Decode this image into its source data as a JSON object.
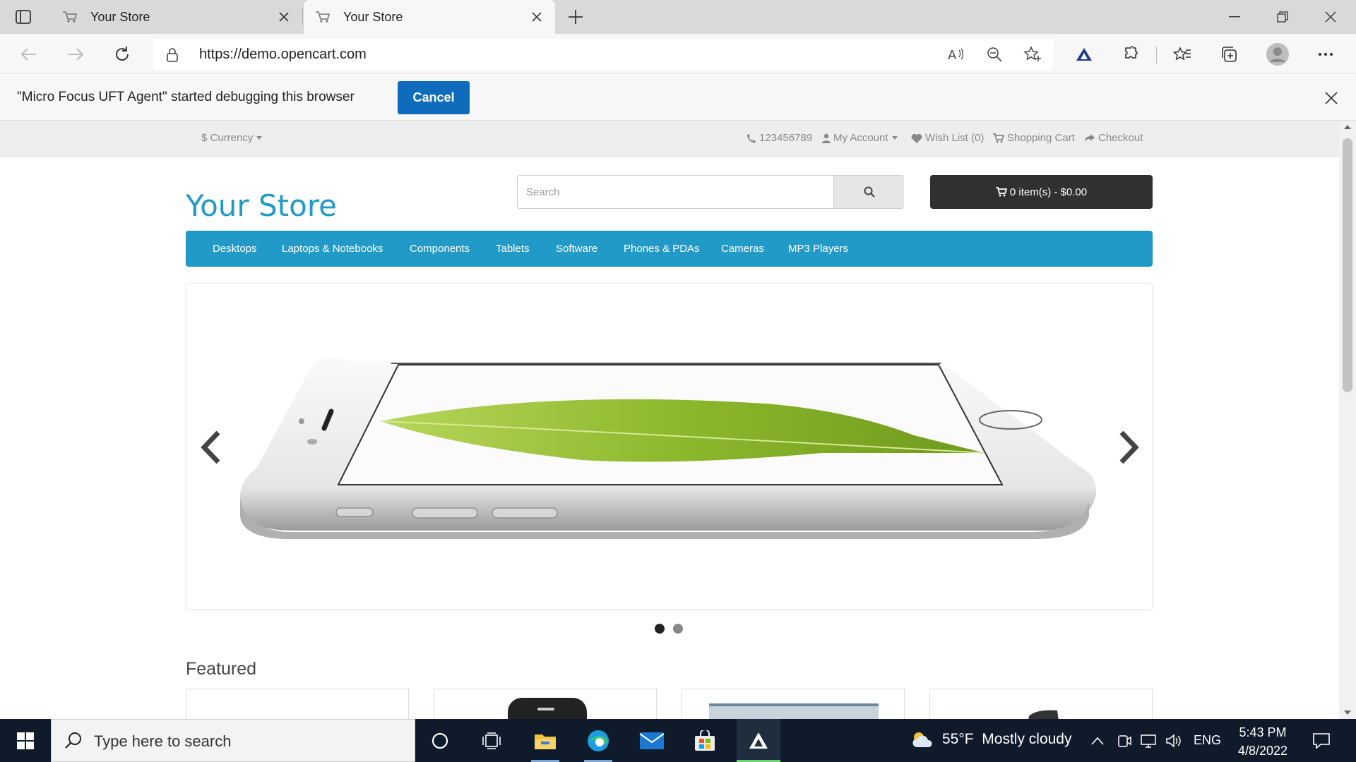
{
  "browser": {
    "tabs": [
      {
        "title": "Your Store",
        "state": "inactive"
      },
      {
        "title": "Your Store",
        "state": "active"
      }
    ],
    "address": {
      "url": "https://demo.opencart.com"
    },
    "infobar": {
      "message": "\"Micro Focus UFT Agent\" started debugging this browser",
      "cancel_label": "Cancel"
    },
    "accent_color": "#0f6cbd"
  },
  "store": {
    "topbar": {
      "currency_label": "Currency",
      "currency_symbol": "$",
      "phone": "123456789",
      "my_account": "My Account",
      "wish_list": "Wish List (0)",
      "shopping_cart": "Shopping Cart",
      "checkout": "Checkout"
    },
    "logo": "Your Store",
    "search": {
      "placeholder": "Search"
    },
    "cart_button": "0 item(s) - $0.00",
    "menu": [
      "Desktops",
      "Laptops & Notebooks",
      "Components",
      "Tablets",
      "Software",
      "Phones & PDAs",
      "Cameras",
      "MP3 Players"
    ],
    "slideshow": {
      "slide_count": 2,
      "active_slide": 1
    },
    "featured_title": "Featured",
    "brand_color": "#229ac8"
  },
  "taskbar": {
    "search_placeholder": "Type here to search",
    "weather": {
      "temp": "55°F",
      "condition": "Mostly cloudy"
    },
    "language": "ENG",
    "time": "5:43 PM",
    "date": "4/8/2022"
  }
}
